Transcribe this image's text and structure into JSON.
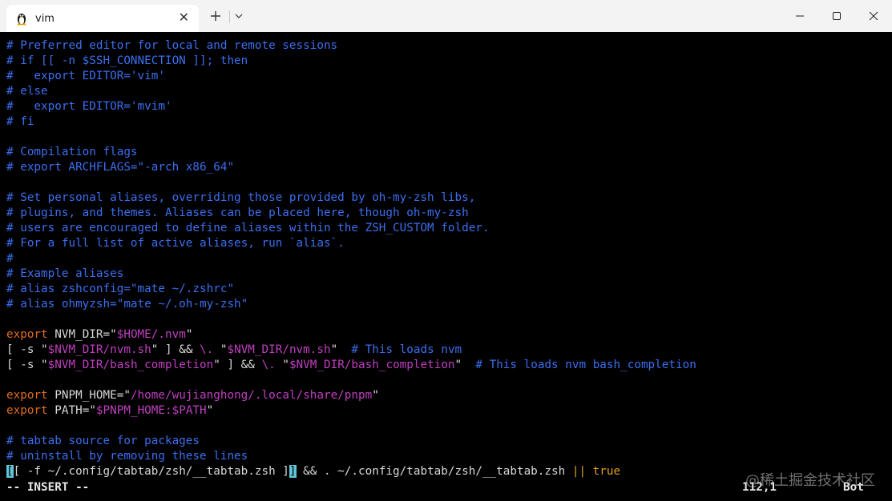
{
  "window": {
    "tab_title": "vim",
    "tab_icon": "linux-penguin-icon",
    "close_tab_icon": "close-icon",
    "new_tab_icon": "plus-icon",
    "dropdown_icon": "chevron-down-icon",
    "controls": [
      "minimize-icon",
      "maximize-icon",
      "close-icon"
    ]
  },
  "colors": {
    "comment": "#3b6ef0",
    "keyword": "#e06c1a",
    "string": "#c03ec0",
    "text": "#d8d8d8",
    "cursor": "#5ec4d8",
    "background": "#000000"
  },
  "editor": {
    "lines": [
      "# Preferred editor for local and remote sessions",
      "# if [[ -n $SSH_CONNECTION ]]; then",
      "#   export EDITOR='vim'",
      "# else",
      "#   export EDITOR='mvim'",
      "# fi",
      "",
      "# Compilation flags",
      "# export ARCHFLAGS=\"-arch x86_64\"",
      "",
      "# Set personal aliases, overriding those provided by oh-my-zsh libs,",
      "# plugins, and themes. Aliases can be placed here, though oh-my-zsh",
      "# users are encouraged to define aliases within the ZSH_CUSTOM folder.",
      "# For a full list of active aliases, run `alias`.",
      "#",
      "# Example aliases",
      "# alias zshconfig=\"mate ~/.zshrc\"",
      "# alias ohmyzsh=\"mate ~/.oh-my-zsh\"",
      "",
      "export NVM_DIR=\"$HOME/.nvm\"",
      "[ -s \"$NVM_DIR/nvm.sh\" ] && \\. \"$NVM_DIR/nvm.sh\"  # This loads nvm",
      "[ -s \"$NVM_DIR/bash_completion\" ] && \\. \"$NVM_DIR/bash_completion\"  # This loads nvm bash_completion",
      "",
      "export PNPM_HOME=\"/home/wujianghong/.local/share/pnpm\"",
      "export PATH=\"$PNPM_HOME:$PATH\"",
      "",
      "# tabtab source for packages",
      "# uninstall by removing these lines",
      "[[ -f ~/.config/tabtab/zsh/__tabtab.zsh ]] && . ~/.config/tabtab/zsh/__tabtab.zsh || true"
    ]
  },
  "status": {
    "mode": "-- INSERT --",
    "position": "112,1",
    "scroll": "Bot"
  },
  "watermark": "@稀土掘金技术社区"
}
